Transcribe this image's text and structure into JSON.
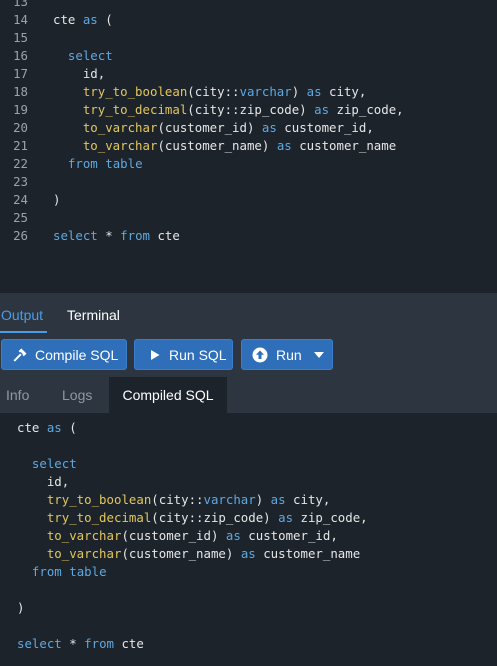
{
  "editor": {
    "lines": [
      {
        "num": "13",
        "tokens": [
          {
            "t": "",
            "c": "pn"
          }
        ]
      },
      {
        "num": "14",
        "tokens": [
          {
            "t": "cte ",
            "c": "pn"
          },
          {
            "t": "as",
            "c": "kw"
          },
          {
            "t": " (",
            "c": "pn"
          }
        ]
      },
      {
        "num": "15",
        "tokens": [
          {
            "t": "",
            "c": "pn"
          }
        ]
      },
      {
        "num": "16",
        "tokens": [
          {
            "t": "  ",
            "c": "pn"
          },
          {
            "t": "select",
            "c": "kw"
          }
        ]
      },
      {
        "num": "17",
        "tokens": [
          {
            "t": "    id,",
            "c": "pn"
          }
        ]
      },
      {
        "num": "18",
        "tokens": [
          {
            "t": "    ",
            "c": "pn"
          },
          {
            "t": "try_to_boolean",
            "c": "fn"
          },
          {
            "t": "(city::",
            "c": "pn"
          },
          {
            "t": "varchar",
            "c": "kw"
          },
          {
            "t": ") ",
            "c": "pn"
          },
          {
            "t": "as",
            "c": "kw"
          },
          {
            "t": " city,",
            "c": "pn"
          }
        ]
      },
      {
        "num": "19",
        "tokens": [
          {
            "t": "    ",
            "c": "pn"
          },
          {
            "t": "try_to_decimal",
            "c": "fn"
          },
          {
            "t": "(city::zip_code) ",
            "c": "pn"
          },
          {
            "t": "as",
            "c": "kw"
          },
          {
            "t": " zip_code,",
            "c": "pn"
          }
        ]
      },
      {
        "num": "20",
        "tokens": [
          {
            "t": "    ",
            "c": "pn"
          },
          {
            "t": "to_varchar",
            "c": "fn"
          },
          {
            "t": "(customer_id) ",
            "c": "pn"
          },
          {
            "t": "as",
            "c": "kw"
          },
          {
            "t": " customer_id,",
            "c": "pn"
          }
        ]
      },
      {
        "num": "21",
        "tokens": [
          {
            "t": "    ",
            "c": "pn"
          },
          {
            "t": "to_varchar",
            "c": "fn"
          },
          {
            "t": "(customer_name) ",
            "c": "pn"
          },
          {
            "t": "as",
            "c": "kw"
          },
          {
            "t": " customer_name",
            "c": "pn"
          }
        ]
      },
      {
        "num": "22",
        "tokens": [
          {
            "t": "  ",
            "c": "pn"
          },
          {
            "t": "from",
            "c": "kw"
          },
          {
            "t": " ",
            "c": "pn"
          },
          {
            "t": "table",
            "c": "kw"
          }
        ]
      },
      {
        "num": "23",
        "tokens": [
          {
            "t": "",
            "c": "pn"
          }
        ]
      },
      {
        "num": "24",
        "tokens": [
          {
            "t": ")",
            "c": "pn"
          }
        ]
      },
      {
        "num": "25",
        "tokens": [
          {
            "t": "",
            "c": "pn"
          }
        ]
      },
      {
        "num": "26",
        "tokens": [
          {
            "t": "select",
            "c": "kw"
          },
          {
            "t": " * ",
            "c": "pn"
          },
          {
            "t": "from",
            "c": "kw"
          },
          {
            "t": " cte",
            "c": "pn"
          }
        ]
      }
    ]
  },
  "panel_tabs": {
    "output": "Output",
    "terminal": "Terminal"
  },
  "toolbar": {
    "compile_label": "Compile SQL",
    "run_sql_label": "Run SQL",
    "run_label": "Run"
  },
  "sub_tabs": {
    "info": "Info",
    "logs": "Logs",
    "compiled": "Compiled SQL"
  },
  "compiled": {
    "lines": [
      {
        "tokens": [
          {
            "t": "cte ",
            "c": "pn"
          },
          {
            "t": "as",
            "c": "kw"
          },
          {
            "t": " (",
            "c": "pn"
          }
        ]
      },
      {
        "tokens": [
          {
            "t": "",
            "c": "pn"
          }
        ]
      },
      {
        "tokens": [
          {
            "t": "  ",
            "c": "pn"
          },
          {
            "t": "select",
            "c": "kw"
          }
        ]
      },
      {
        "tokens": [
          {
            "t": "    id,",
            "c": "pn"
          }
        ]
      },
      {
        "tokens": [
          {
            "t": "    ",
            "c": "pn"
          },
          {
            "t": "try_to_boolean",
            "c": "fn"
          },
          {
            "t": "(city::",
            "c": "pn"
          },
          {
            "t": "varchar",
            "c": "kw"
          },
          {
            "t": ") ",
            "c": "pn"
          },
          {
            "t": "as",
            "c": "kw"
          },
          {
            "t": " city,",
            "c": "pn"
          }
        ]
      },
      {
        "tokens": [
          {
            "t": "    ",
            "c": "pn"
          },
          {
            "t": "try_to_decimal",
            "c": "fn"
          },
          {
            "t": "(city::zip_code) ",
            "c": "pn"
          },
          {
            "t": "as",
            "c": "kw"
          },
          {
            "t": " zip_code,",
            "c": "pn"
          }
        ]
      },
      {
        "tokens": [
          {
            "t": "    ",
            "c": "pn"
          },
          {
            "t": "to_varchar",
            "c": "fn"
          },
          {
            "t": "(customer_id) ",
            "c": "pn"
          },
          {
            "t": "as",
            "c": "kw"
          },
          {
            "t": " customer_id,",
            "c": "pn"
          }
        ]
      },
      {
        "tokens": [
          {
            "t": "    ",
            "c": "pn"
          },
          {
            "t": "to_varchar",
            "c": "fn"
          },
          {
            "t": "(customer_name) ",
            "c": "pn"
          },
          {
            "t": "as",
            "c": "kw"
          },
          {
            "t": " customer_name",
            "c": "pn"
          }
        ]
      },
      {
        "tokens": [
          {
            "t": "  ",
            "c": "pn"
          },
          {
            "t": "from",
            "c": "kw"
          },
          {
            "t": " ",
            "c": "pn"
          },
          {
            "t": "table",
            "c": "kw"
          }
        ]
      },
      {
        "tokens": [
          {
            "t": "",
            "c": "pn"
          }
        ]
      },
      {
        "tokens": [
          {
            "t": ")",
            "c": "pn"
          }
        ]
      },
      {
        "tokens": [
          {
            "t": "",
            "c": "pn"
          }
        ]
      },
      {
        "tokens": [
          {
            "t": "select",
            "c": "kw"
          },
          {
            "t": " * ",
            "c": "pn"
          },
          {
            "t": "from",
            "c": "kw"
          },
          {
            "t": " cte",
            "c": "pn"
          }
        ]
      }
    ]
  },
  "colors": {
    "background": "#1c232b",
    "panel": "#2d3540",
    "accent": "#4c9be8",
    "button": "#2f6eb8",
    "keyword": "#5fa8e0",
    "function": "#e3c75a"
  },
  "icons": {
    "compile": "hammer-icon",
    "run_sql": "play-icon",
    "run": "arrow-up-circle-icon",
    "dropdown": "caret-down-icon"
  }
}
